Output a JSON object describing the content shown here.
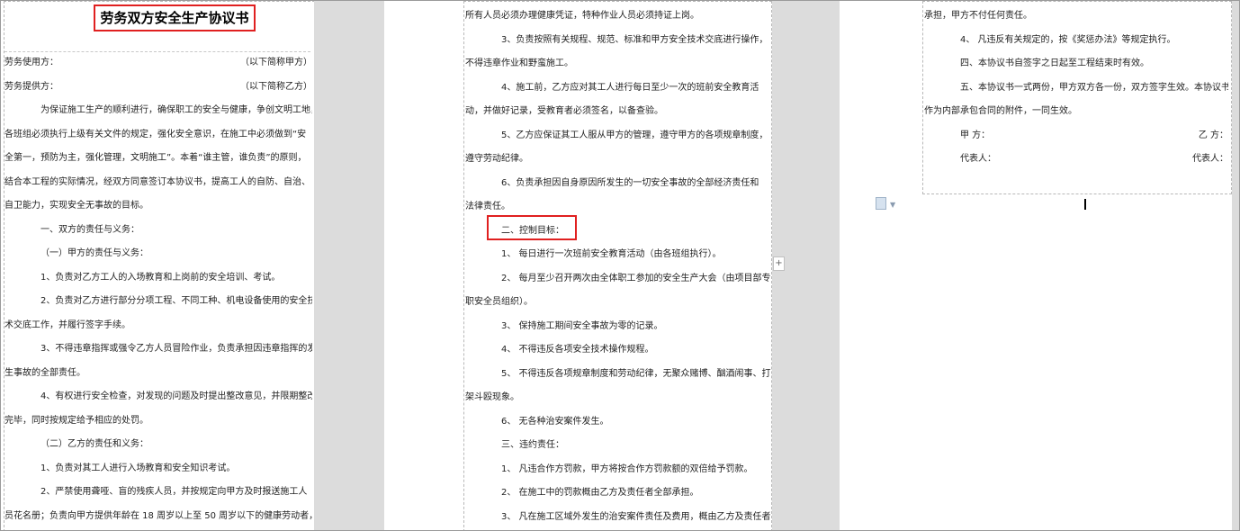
{
  "page1": {
    "title": "劳务双方安全生产协议书",
    "lines": [
      {
        "kind": "split",
        "left": "劳务使用方：",
        "right": "（以下简称甲方）"
      },
      {
        "kind": "split",
        "left": "劳务提供方：",
        "right": "（以下简称乙方）"
      },
      {
        "kind": "ind",
        "text": "为保证施工生产的顺利进行，确保职工的安全与健康，争创文明工地，"
      },
      {
        "kind": "flush",
        "text": "各班组必须执行上级有关文件的规定，强化安全意识，在施工中必须做到“安"
      },
      {
        "kind": "flush",
        "text": "全第一，预防为主，强化管理，文明施工”。本着“谁主管，谁负责”的原则，"
      },
      {
        "kind": "flush",
        "text": "结合本工程的实际情况，经双方同意签订本协议书，提高工人的自防、自治、"
      },
      {
        "kind": "flush",
        "text": "自卫能力，实现安全无事故的目标。"
      },
      {
        "kind": "ind",
        "text": "一、双方的责任与义务："
      },
      {
        "kind": "ind",
        "text": "（一）甲方的责任与义务："
      },
      {
        "kind": "ind",
        "text": "1、负责对乙方工人的入场教育和上岗前的安全培训、考试。"
      },
      {
        "kind": "ind",
        "text": "2、负责对乙方进行部分分项工程、不同工种、机电设备使用的安全技"
      },
      {
        "kind": "flush",
        "text": "术交底工作，并履行签字手续。"
      },
      {
        "kind": "ind",
        "text": "3、不得违章指挥或强令乙方人员冒险作业，负责承担因违章指挥的发"
      },
      {
        "kind": "flush",
        "text": "生事故的全部责任。"
      },
      {
        "kind": "ind",
        "text": "4、有权进行安全检查，对发现的问题及时提出整改意见，并限期整改"
      },
      {
        "kind": "flush",
        "text": "完毕，同时按规定给予相应的处罚。"
      },
      {
        "kind": "ind",
        "text": "（二）乙方的责任和义务："
      },
      {
        "kind": "ind",
        "text": "1、负责对其工人进行入场教育和安全知识考试。"
      },
      {
        "kind": "ind",
        "text": "2、严禁使用聋哑、盲的残疾人员，并按规定向甲方及时报送施工人"
      },
      {
        "kind": "flush",
        "text": "员花名册；负责向甲方提供年龄在 18 周岁以上至 50 周岁以下的健康劳动者，"
      }
    ]
  },
  "page2": {
    "lines": [
      {
        "kind": "flush",
        "text": "所有人员必须办理健康凭证，特种作业人员必须持证上岗。"
      },
      {
        "kind": "ind",
        "text": "3、负责按照有关规程、规范、标准和甲方安全技术交底进行操作，"
      },
      {
        "kind": "flush",
        "text": "不得违章作业和野蛮施工。"
      },
      {
        "kind": "ind",
        "text": "4、施工前，乙方应对其工人进行每日至少一次的班前安全教育活"
      },
      {
        "kind": "flush",
        "text": "动，并做好记录，受教育者必须签名，以备查验。"
      },
      {
        "kind": "ind",
        "text": "5、乙方应保证其工人服从甲方的管理，遵守甲方的各项规章制度，"
      },
      {
        "kind": "flush",
        "text": "遵守劳动纪律。"
      },
      {
        "kind": "ind",
        "text": "6、负责承担因自身原因所发生的一切安全事故的全部经济责任和"
      },
      {
        "kind": "flush",
        "text": "法律责任。"
      },
      {
        "kind": "ind",
        "text": "二、控制目标："
      },
      {
        "kind": "ind",
        "text": "1、    每日进行一次班前安全教育活动（由各班组执行）。"
      },
      {
        "kind": "ind",
        "text": "2、    每月至少召开两次由全体职工参加的安全生产大会（由项目部专"
      },
      {
        "kind": "flush",
        "text": "职安全员组织）。"
      },
      {
        "kind": "ind",
        "text": "3、    保持施工期间安全事故为零的记录。"
      },
      {
        "kind": "ind",
        "text": "4、    不得违反各项安全技术操作规程。"
      },
      {
        "kind": "ind",
        "text": "5、    不得违反各项规章制度和劳动纪律，无聚众赌博、酗酒闹事、打"
      },
      {
        "kind": "flush",
        "text": "架斗殴现象。"
      },
      {
        "kind": "ind",
        "text": "6、    无各种治安案件发生。"
      },
      {
        "kind": "ind",
        "text": "三、违约责任："
      },
      {
        "kind": "ind",
        "text": "1、    凡违合作方罚款，甲方将按合作方罚款额的双倍给予罚款。"
      },
      {
        "kind": "ind",
        "text": "2、    在施工中的罚款概由乙方及责任者全部承担。"
      },
      {
        "kind": "ind",
        "text": "3、    凡在施工区域外发生的治安案件责任及费用，概由乙方及责任者"
      }
    ]
  },
  "page3": {
    "lines": [
      {
        "kind": "flush",
        "text": "承担，甲方不付任何责任。"
      },
      {
        "kind": "ind",
        "text": "4、    凡违反有关规定的，按《奖惩办法》等规定执行。"
      },
      {
        "kind": "ind",
        "text": "四、本协议书自签字之日起至工程结束时有效。"
      },
      {
        "kind": "ind",
        "text": "五、本协议书一式两份，甲方双方各一份，双方签字生效。本协议书"
      },
      {
        "kind": "flush",
        "text": "作为内部承包合同的附件，一同生效。"
      },
      {
        "kind": "split",
        "left": "甲      方：",
        "right": "乙      方："
      },
      {
        "kind": "split",
        "left": "代表人：",
        "right": "代表人："
      }
    ]
  }
}
